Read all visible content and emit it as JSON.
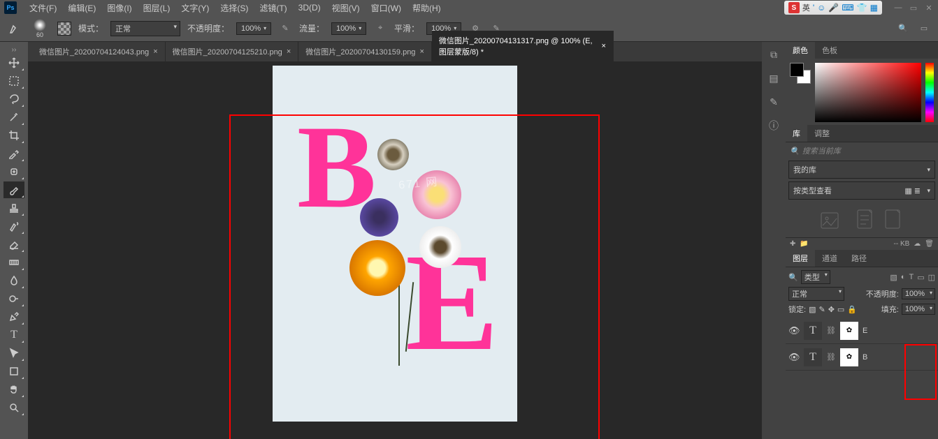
{
  "menu": {
    "items": [
      "文件(F)",
      "编辑(E)",
      "图像(I)",
      "图层(L)",
      "文字(Y)",
      "选择(S)",
      "滤镜(T)",
      "3D(D)",
      "视图(V)",
      "窗口(W)",
      "帮助(H)"
    ]
  },
  "ime": {
    "lang": "英",
    "logo": "S"
  },
  "optbar": {
    "brush_size": "60",
    "mode_label": "模式：",
    "mode_value": "正常",
    "opacity_label": "不透明度：",
    "opacity_value": "100%",
    "flow_label": "流量：",
    "flow_value": "100%",
    "smooth_label": "平滑：",
    "smooth_value": "100%"
  },
  "tabs": [
    {
      "title": "微信图片_20200704124043.png",
      "active": false
    },
    {
      "title": "微信图片_20200704125210.png",
      "active": false
    },
    {
      "title": "微信图片_20200704130159.png",
      "active": false
    },
    {
      "title": "微信图片_20200704131317.png @ 100% (E, 图层蒙版/8) *",
      "active": true
    }
  ],
  "canvas": {
    "letter_b": "B",
    "letter_e": "E",
    "watermark": "671 网"
  },
  "panels": {
    "color_tab": "颜色",
    "swatches_tab": "色板",
    "lib_tab": "库",
    "adjust_tab": "调整",
    "lib_search_placeholder": "搜索当前库",
    "lib_my": "我的库",
    "lib_view": "按类型查看",
    "lib_size": "-- KB",
    "layers_tab": "图层",
    "channels_tab": "通道",
    "paths_tab": "路径",
    "kind_label": "类型",
    "blend_mode": "正常",
    "opacity_label": "不透明度:",
    "opacity_val": "100%",
    "lock_label": "锁定:",
    "fill_label": "填充:",
    "fill_val": "100%",
    "layer_e": "E",
    "layer_b": "B"
  },
  "search": {
    "icon": "🔍"
  }
}
